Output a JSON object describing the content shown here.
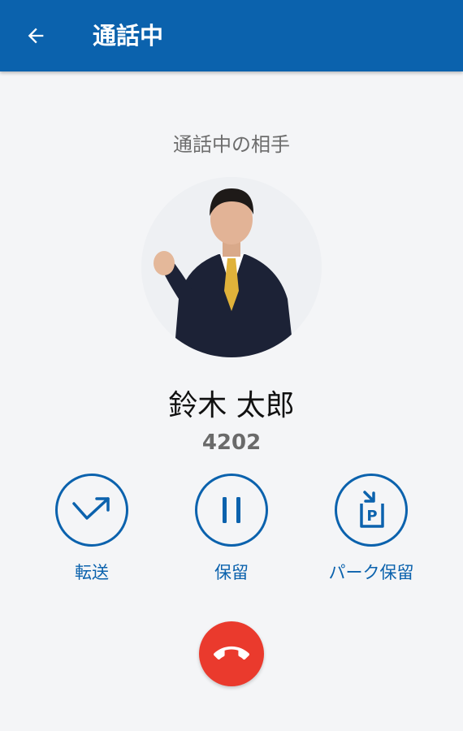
{
  "appbar": {
    "title": "通話中",
    "back_icon": "arrow-back-icon",
    "color": "#0b62ad"
  },
  "call": {
    "caption": "通話中の相手",
    "name": "鈴木 太郎",
    "extension": "4202"
  },
  "actions": [
    {
      "label": "転送",
      "icon": "transfer-icon"
    },
    {
      "label": "保留",
      "icon": "pause-icon"
    },
    {
      "label": "パーク保留",
      "icon": "park-hold-icon"
    }
  ],
  "hangup": {
    "icon": "end-call-icon",
    "color": "#ea3a2d"
  }
}
